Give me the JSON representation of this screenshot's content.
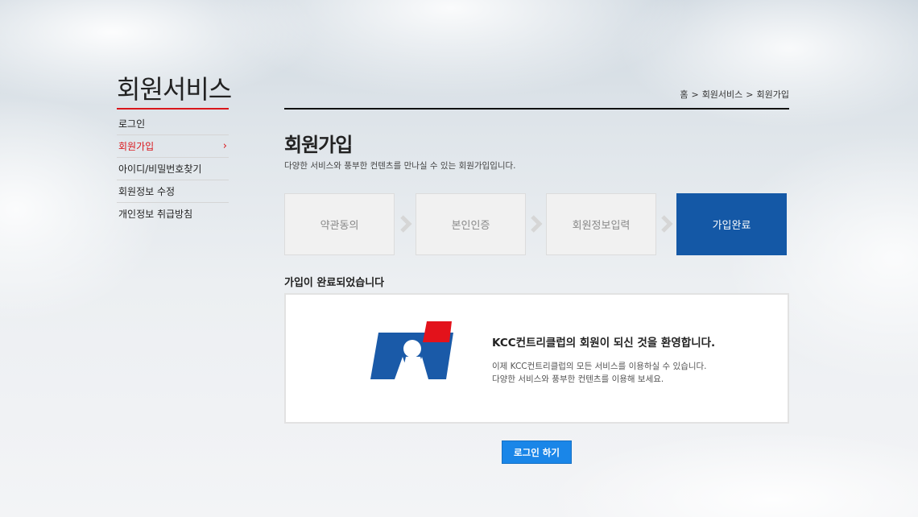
{
  "sidebar": {
    "title": "회원서비스",
    "items": [
      {
        "label": "로그인"
      },
      {
        "label": "회원가입",
        "active": true
      },
      {
        "label": "아이디/비밀번호찾기"
      },
      {
        "label": "회원정보 수정"
      },
      {
        "label": "개인정보 취급방침"
      }
    ]
  },
  "breadcrumb": {
    "home": "홈",
    "separator": ">",
    "level1": "회원서비스",
    "level2": "회원가입"
  },
  "page": {
    "title": "회원가입",
    "description": "다양한 서비스와 풍부한 컨텐츠를 만나실 수 있는 회원가입입니다."
  },
  "steps": [
    {
      "label": "약관동의",
      "done": false
    },
    {
      "label": "본인인증",
      "done": false
    },
    {
      "label": "회원정보입력",
      "done": false
    },
    {
      "label": "가입완료",
      "done": true
    }
  ],
  "completion": {
    "section_title": "가입이 완료되었습니다",
    "headline": "KCC컨트리클럽의 회원이 되신 것을 환영합니다.",
    "line1": "이제 KCC컨트리클럽의 모든 서비스를 이용하실 수 있습니다.",
    "line2": "다양한 서비스와 풍부한 컨텐츠를 이용해 보세요."
  },
  "login_button": "로그인 하기",
  "colors": {
    "accent_red": "#d9161b",
    "step_active": "#1458a6",
    "button_blue": "#1a86e8",
    "logo_blue": "#1a5aa8",
    "logo_red": "#e3121b"
  },
  "icons": {
    "step_arrow": "chevron-right-icon",
    "menu_arrow": "chevron-right-icon",
    "logo": "kcc-logo-icon"
  }
}
